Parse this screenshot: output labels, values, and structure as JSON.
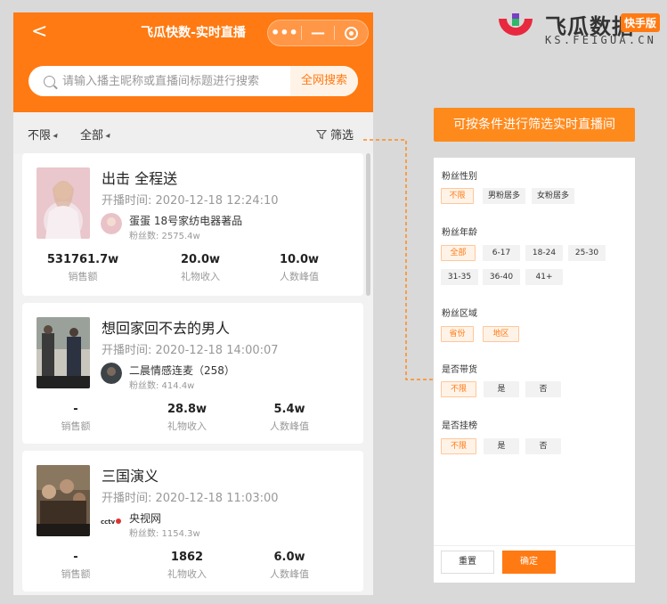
{
  "nav": {
    "back_glyph": "<",
    "title": "飞瓜快数-实时直播",
    "more_glyph": "•••",
    "minimize_glyph": "—"
  },
  "search": {
    "placeholder": "请输入播主昵称或直播间标题进行搜索",
    "button": "全网搜索"
  },
  "filterbar": {
    "filter1": "不限",
    "filter2": "全部",
    "filter_button": "筛选"
  },
  "streams": [
    {
      "title": "出击 全程送",
      "time": "开播时间: 2020-12-18 12:24:10",
      "host": "蛋蛋 18号家纺电器著品",
      "fans": "粉丝数: 2575.4w",
      "stats": [
        {
          "value": "531761.7w",
          "label": "销售额"
        },
        {
          "value": "20.0w",
          "label": "礼物收入"
        },
        {
          "value": "10.0w",
          "label": "人数峰值"
        }
      ]
    },
    {
      "title": "想回家回不去的男人",
      "time": "开播时间: 2020-12-18 14:00:07",
      "host": "二晨情感连麦（258）",
      "fans": "粉丝数: 414.4w",
      "stats": [
        {
          "value": "-",
          "label": "销售额"
        },
        {
          "value": "28.8w",
          "label": "礼物收入"
        },
        {
          "value": "5.4w",
          "label": "人数峰值"
        }
      ]
    },
    {
      "title": "三国演义",
      "time": "开播时间: 2020-12-18 11:03:00",
      "host": "央视网",
      "fans": "粉丝数: 1154.3w",
      "stats": [
        {
          "value": "-",
          "label": "销售额"
        },
        {
          "value": "1862",
          "label": "礼物收入"
        },
        {
          "value": "6.0w",
          "label": "人数峰值"
        }
      ]
    }
  ],
  "logo": {
    "cn": "飞瓜数据",
    "badge": "快手版",
    "en": "KS.FEIGUA.CN"
  },
  "callout": "可按条件进行筛选实时直播间",
  "panel": {
    "sections": [
      {
        "title": "粉丝性别",
        "options": [
          "不限",
          "男粉居多",
          "女粉居多"
        ],
        "selected": "不限"
      },
      {
        "title": "粉丝年龄",
        "options": [
          "全部",
          "6-17",
          "18-24",
          "25-30",
          "31-35",
          "36-40",
          "41+"
        ],
        "selected": "全部"
      },
      {
        "title": "粉丝区域",
        "options": [
          "省份",
          "地区"
        ],
        "selected": "省份,地区"
      },
      {
        "title": "是否带货",
        "options": [
          "不限",
          "是",
          "否"
        ],
        "selected": "不限"
      },
      {
        "title": "是否挂榜",
        "options": [
          "不限",
          "是",
          "否"
        ],
        "selected": "不限"
      }
    ],
    "reset": "重置",
    "confirm": "确定"
  },
  "colors": {
    "accent": "#ff7a12",
    "callout": "#ff8a1c",
    "background": "#d9d9d9"
  },
  "icons": [
    "back-icon",
    "more-icon",
    "minimize-icon",
    "target-icon",
    "search-icon",
    "caret-icon",
    "funnel-icon",
    "feigua-logo-icon"
  ]
}
